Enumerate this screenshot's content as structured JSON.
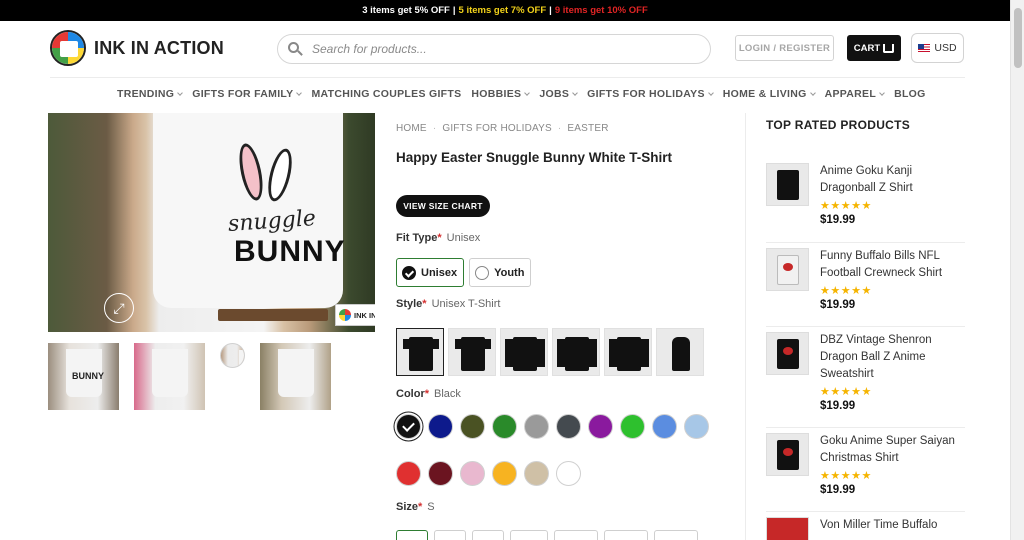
{
  "promo": {
    "part1": "3 items get 5% OFF",
    "sep1": "|",
    "part2": "5 items get 7% OFF",
    "sep2": "|",
    "part3": "9 items get 10% OFF"
  },
  "header": {
    "brand": "INK IN ACTION",
    "search_placeholder": "Search for products...",
    "login_label": "LOGIN / REGISTER",
    "cart_label": "CART",
    "currency": "USD"
  },
  "nav": {
    "items": [
      {
        "label": "TRENDING",
        "has_dropdown": true
      },
      {
        "label": "GIFTS FOR FAMILY",
        "has_dropdown": true
      },
      {
        "label": "MATCHING COUPLES GIFTS",
        "has_dropdown": false
      },
      {
        "label": "HOBBIES",
        "has_dropdown": true
      },
      {
        "label": "JOBS",
        "has_dropdown": true
      },
      {
        "label": "GIFTS FOR HOLIDAYS",
        "has_dropdown": true
      },
      {
        "label": "HOME & LIVING",
        "has_dropdown": true
      },
      {
        "label": "APPAREL",
        "has_dropdown": true
      },
      {
        "label": "BLOG",
        "has_dropdown": false
      }
    ]
  },
  "gallery": {
    "main_line1": "snuggle",
    "main_line2": "BUNNY",
    "watermark": "INK IN ACTION",
    "thumb_text": "BUNNY"
  },
  "product": {
    "breadcrumb": [
      "HOME",
      "GIFTS FOR HOLIDAYS",
      "EASTER"
    ],
    "breadcrumb_sep": "·",
    "title": "Happy Easter Snuggle Bunny White T-Shirt",
    "size_chart_label": "VIEW SIZE CHART",
    "fit_type": {
      "label": "Fit Type",
      "required": "*",
      "value": "Unisex",
      "options": [
        "Unisex",
        "Youth"
      ]
    },
    "style": {
      "label": "Style",
      "required": "*",
      "value": "Unisex T-Shirt"
    },
    "color": {
      "label": "Color",
      "required": "*",
      "value": "Black",
      "swatches_row1": [
        "#111111",
        "#0d1a8c",
        "#4a5223",
        "#2a8a2a",
        "#9a9a9a",
        "#444a4f",
        "#8a1a9e",
        "#2ec02e",
        "#5b8de0",
        "#a7c7e7"
      ],
      "swatches_row2": [
        "#e03030",
        "#6b1420",
        "#e9b8cf",
        "#f7b321",
        "#cfc0a6",
        "#ffffff"
      ]
    },
    "size": {
      "label": "Size",
      "required": "*",
      "value": "S"
    }
  },
  "sidebar": {
    "title": "TOP RATED PRODUCTS",
    "products": [
      {
        "name": "Anime Goku Kanji Dragonball Z Shirt",
        "stars": "★★★★★",
        "price": "$19.99"
      },
      {
        "name": "Funny Buffalo Bills NFL Football Crewneck Shirt",
        "stars": "★★★★★",
        "price": "$19.99"
      },
      {
        "name": "DBZ Vintage Shenron Dragon Ball Z Anime Sweatshirt",
        "stars": "★★★★★",
        "price": "$19.99"
      },
      {
        "name": "Goku Anime Super Saiyan Christmas Shirt",
        "stars": "★★★★★",
        "price": "$19.99"
      },
      {
        "name": "Von Miller Time Buffalo",
        "stars": "",
        "price": ""
      }
    ]
  }
}
